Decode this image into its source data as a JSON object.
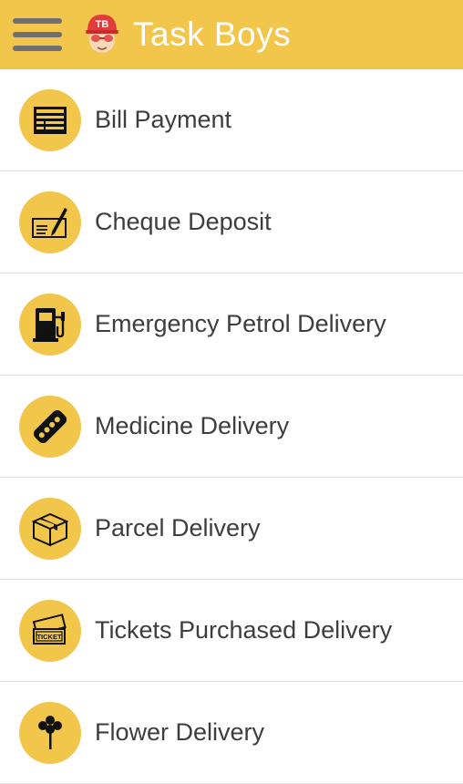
{
  "app": {
    "title": "Task Boys",
    "logo_text": "TB"
  },
  "colors": {
    "accent": "#f1c64a",
    "icon": "#111111",
    "text": "#3d3d3d",
    "divider": "#e2e2e2"
  },
  "services": [
    {
      "label": "Bill Payment",
      "icon": "bill-icon"
    },
    {
      "label": "Cheque Deposit",
      "icon": "cheque-icon"
    },
    {
      "label": "Emergency Petrol Delivery",
      "icon": "petrol-pump-icon"
    },
    {
      "label": "Medicine Delivery",
      "icon": "pills-icon"
    },
    {
      "label": "Parcel Delivery",
      "icon": "parcel-box-icon"
    },
    {
      "label": "Tickets Purchased Delivery",
      "icon": "tickets-icon",
      "ticket_text": "TICKET"
    },
    {
      "label": "Flower Delivery",
      "icon": "flower-icon"
    }
  ]
}
